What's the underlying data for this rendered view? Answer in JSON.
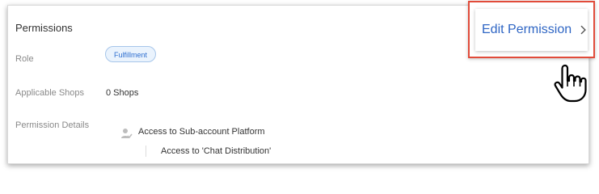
{
  "permissions": {
    "title": "Permissions",
    "role_label": "Role",
    "role_value": "Fulfillment",
    "shops_label": "Applicable Shops",
    "shops_value": "0 Shops",
    "details_label": "Permission Details",
    "details_item": "Access to Sub-account Platform",
    "details_subitem": "Access to 'Chat Distribution'"
  },
  "edit_button": {
    "label": "Edit Permission"
  },
  "icons": {
    "chevron": "chevron-right-icon",
    "permission": "user-permission-icon",
    "cursor": "hand-pointer-icon"
  },
  "colors": {
    "accent": "#2f66c4",
    "highlight": "#e14b3a",
    "chip_bg": "#eaf3fd",
    "chip_border": "#a7c6ea"
  }
}
